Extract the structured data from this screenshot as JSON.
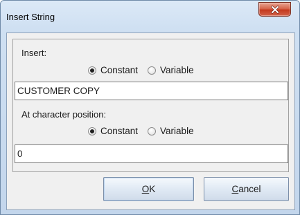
{
  "window": {
    "title": "Insert String"
  },
  "insert": {
    "label": "Insert:",
    "option_constant": "Constant",
    "option_variable": "Variable",
    "selected": "Constant",
    "value": "CUSTOMER COPY"
  },
  "position": {
    "label": "At character position:",
    "option_constant": "Constant",
    "option_variable": "Variable",
    "selected": "Constant",
    "value": "0"
  },
  "buttons": {
    "ok_mnemonic": "O",
    "ok_rest": "K",
    "cancel_mnemonic": "C",
    "cancel_rest": "ancel"
  },
  "icons": {
    "close": "close-icon"
  },
  "colors": {
    "close_button": "#c4391e",
    "window_frame": "#cfe0f2",
    "dialog_background": "#f0f0f0"
  }
}
